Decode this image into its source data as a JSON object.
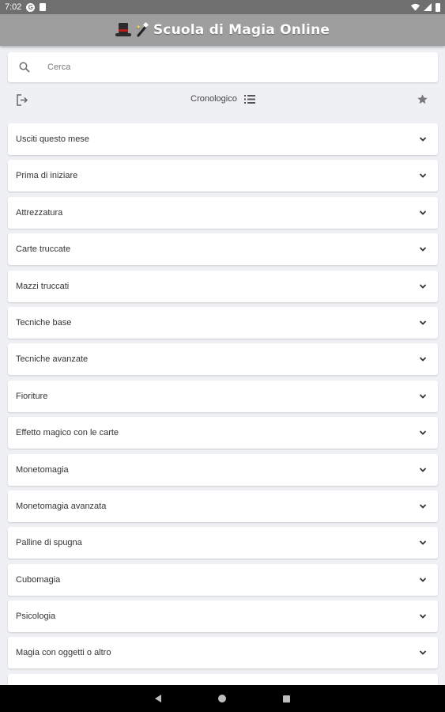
{
  "status_bar": {
    "time": "7:02"
  },
  "app_bar": {
    "title": "Scuola di Magia Online"
  },
  "search": {
    "placeholder": "Cerca",
    "value": ""
  },
  "toolbar": {
    "sort_label": "Cronologico"
  },
  "categories": [
    "Usciti questo mese",
    "Prima di iniziare",
    "Attrezzatura",
    "Carte truccate",
    "Mazzi truccati",
    "Tecniche base",
    "Tecniche avanzate",
    "Fioriture",
    "Effetto magico con le carte",
    "Monetomagia",
    "Monetomagia avanzata",
    "Palline di spugna",
    "Cubomagia",
    "Psicologia",
    "Magia con oggetti o altro",
    ""
  ],
  "icons": {
    "search": "search-icon",
    "logout": "logout-icon",
    "sort": "list-icon",
    "favorites": "star-icon",
    "expand": "chevron-down-icon"
  },
  "colors": {
    "app_bar": "#9e9e9e",
    "status_bar": "#6f6f6f",
    "background": "#eef0f3",
    "card": "#ffffff",
    "nav_bar": "#000000"
  }
}
